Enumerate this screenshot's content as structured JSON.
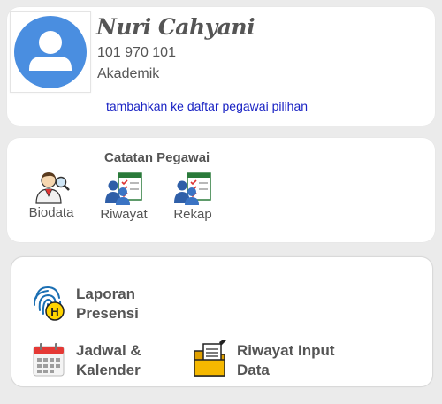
{
  "profile": {
    "name": "Nuri Cahyani",
    "nip": "101 970 101",
    "role": "Akademik",
    "add_link": "tambahkan ke daftar pegawai pilihan",
    "avatar_icon": "user-avatar-icon",
    "accent_color": "#4a8ee0"
  },
  "catatan": {
    "title": "Catatan Pegawai",
    "items": [
      {
        "label": "Biodata",
        "icon": "person-search-icon"
      },
      {
        "label": "Riwayat",
        "icon": "users-checklist-icon"
      },
      {
        "label": "Rekap",
        "icon": "users-checklist-icon"
      }
    ]
  },
  "menu": {
    "items": [
      {
        "line1": "Laporan",
        "line2": "Presensi",
        "icon": "fingerprint-icon"
      },
      {
        "line1": "Jadwal &",
        "line2": "Kalender",
        "icon": "calendar-icon"
      },
      {
        "line1": "Riwayat Input",
        "line2": "Data",
        "icon": "folder-document-icon"
      }
    ]
  },
  "colors": {
    "background": "#ebebeb",
    "card": "#ffffff",
    "text": "#555555",
    "link": "#1a23c4"
  }
}
